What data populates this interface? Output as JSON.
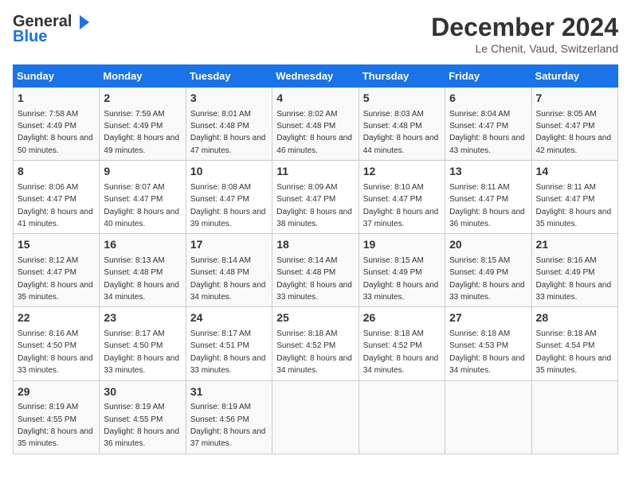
{
  "header": {
    "logo_line1": "General",
    "logo_line2": "Blue",
    "month": "December 2024",
    "location": "Le Chenit, Vaud, Switzerland"
  },
  "days_of_week": [
    "Sunday",
    "Monday",
    "Tuesday",
    "Wednesday",
    "Thursday",
    "Friday",
    "Saturday"
  ],
  "weeks": [
    [
      {
        "day": "1",
        "sunrise": "Sunrise: 7:58 AM",
        "sunset": "Sunset: 4:49 PM",
        "daylight": "Daylight: 8 hours and 50 minutes."
      },
      {
        "day": "2",
        "sunrise": "Sunrise: 7:59 AM",
        "sunset": "Sunset: 4:49 PM",
        "daylight": "Daylight: 8 hours and 49 minutes."
      },
      {
        "day": "3",
        "sunrise": "Sunrise: 8:01 AM",
        "sunset": "Sunset: 4:48 PM",
        "daylight": "Daylight: 8 hours and 47 minutes."
      },
      {
        "day": "4",
        "sunrise": "Sunrise: 8:02 AM",
        "sunset": "Sunset: 4:48 PM",
        "daylight": "Daylight: 8 hours and 46 minutes."
      },
      {
        "day": "5",
        "sunrise": "Sunrise: 8:03 AM",
        "sunset": "Sunset: 4:48 PM",
        "daylight": "Daylight: 8 hours and 44 minutes."
      },
      {
        "day": "6",
        "sunrise": "Sunrise: 8:04 AM",
        "sunset": "Sunset: 4:47 PM",
        "daylight": "Daylight: 8 hours and 43 minutes."
      },
      {
        "day": "7",
        "sunrise": "Sunrise: 8:05 AM",
        "sunset": "Sunset: 4:47 PM",
        "daylight": "Daylight: 8 hours and 42 minutes."
      }
    ],
    [
      {
        "day": "8",
        "sunrise": "Sunrise: 8:06 AM",
        "sunset": "Sunset: 4:47 PM",
        "daylight": "Daylight: 8 hours and 41 minutes."
      },
      {
        "day": "9",
        "sunrise": "Sunrise: 8:07 AM",
        "sunset": "Sunset: 4:47 PM",
        "daylight": "Daylight: 8 hours and 40 minutes."
      },
      {
        "day": "10",
        "sunrise": "Sunrise: 8:08 AM",
        "sunset": "Sunset: 4:47 PM",
        "daylight": "Daylight: 8 hours and 39 minutes."
      },
      {
        "day": "11",
        "sunrise": "Sunrise: 8:09 AM",
        "sunset": "Sunset: 4:47 PM",
        "daylight": "Daylight: 8 hours and 38 minutes."
      },
      {
        "day": "12",
        "sunrise": "Sunrise: 8:10 AM",
        "sunset": "Sunset: 4:47 PM",
        "daylight": "Daylight: 8 hours and 37 minutes."
      },
      {
        "day": "13",
        "sunrise": "Sunrise: 8:11 AM",
        "sunset": "Sunset: 4:47 PM",
        "daylight": "Daylight: 8 hours and 36 minutes."
      },
      {
        "day": "14",
        "sunrise": "Sunrise: 8:11 AM",
        "sunset": "Sunset: 4:47 PM",
        "daylight": "Daylight: 8 hours and 35 minutes."
      }
    ],
    [
      {
        "day": "15",
        "sunrise": "Sunrise: 8:12 AM",
        "sunset": "Sunset: 4:47 PM",
        "daylight": "Daylight: 8 hours and 35 minutes."
      },
      {
        "day": "16",
        "sunrise": "Sunrise: 8:13 AM",
        "sunset": "Sunset: 4:48 PM",
        "daylight": "Daylight: 8 hours and 34 minutes."
      },
      {
        "day": "17",
        "sunrise": "Sunrise: 8:14 AM",
        "sunset": "Sunset: 4:48 PM",
        "daylight": "Daylight: 8 hours and 34 minutes."
      },
      {
        "day": "18",
        "sunrise": "Sunrise: 8:14 AM",
        "sunset": "Sunset: 4:48 PM",
        "daylight": "Daylight: 8 hours and 33 minutes."
      },
      {
        "day": "19",
        "sunrise": "Sunrise: 8:15 AM",
        "sunset": "Sunset: 4:49 PM",
        "daylight": "Daylight: 8 hours and 33 minutes."
      },
      {
        "day": "20",
        "sunrise": "Sunrise: 8:15 AM",
        "sunset": "Sunset: 4:49 PM",
        "daylight": "Daylight: 8 hours and 33 minutes."
      },
      {
        "day": "21",
        "sunrise": "Sunrise: 8:16 AM",
        "sunset": "Sunset: 4:49 PM",
        "daylight": "Daylight: 8 hours and 33 minutes."
      }
    ],
    [
      {
        "day": "22",
        "sunrise": "Sunrise: 8:16 AM",
        "sunset": "Sunset: 4:50 PM",
        "daylight": "Daylight: 8 hours and 33 minutes."
      },
      {
        "day": "23",
        "sunrise": "Sunrise: 8:17 AM",
        "sunset": "Sunset: 4:50 PM",
        "daylight": "Daylight: 8 hours and 33 minutes."
      },
      {
        "day": "24",
        "sunrise": "Sunrise: 8:17 AM",
        "sunset": "Sunset: 4:51 PM",
        "daylight": "Daylight: 8 hours and 33 minutes."
      },
      {
        "day": "25",
        "sunrise": "Sunrise: 8:18 AM",
        "sunset": "Sunset: 4:52 PM",
        "daylight": "Daylight: 8 hours and 34 minutes."
      },
      {
        "day": "26",
        "sunrise": "Sunrise: 8:18 AM",
        "sunset": "Sunset: 4:52 PM",
        "daylight": "Daylight: 8 hours and 34 minutes."
      },
      {
        "day": "27",
        "sunrise": "Sunrise: 8:18 AM",
        "sunset": "Sunset: 4:53 PM",
        "daylight": "Daylight: 8 hours and 34 minutes."
      },
      {
        "day": "28",
        "sunrise": "Sunrise: 8:18 AM",
        "sunset": "Sunset: 4:54 PM",
        "daylight": "Daylight: 8 hours and 35 minutes."
      }
    ],
    [
      {
        "day": "29",
        "sunrise": "Sunrise: 8:19 AM",
        "sunset": "Sunset: 4:55 PM",
        "daylight": "Daylight: 8 hours and 35 minutes."
      },
      {
        "day": "30",
        "sunrise": "Sunrise: 8:19 AM",
        "sunset": "Sunset: 4:55 PM",
        "daylight": "Daylight: 8 hours and 36 minutes."
      },
      {
        "day": "31",
        "sunrise": "Sunrise: 8:19 AM",
        "sunset": "Sunset: 4:56 PM",
        "daylight": "Daylight: 8 hours and 37 minutes."
      },
      null,
      null,
      null,
      null
    ]
  ]
}
